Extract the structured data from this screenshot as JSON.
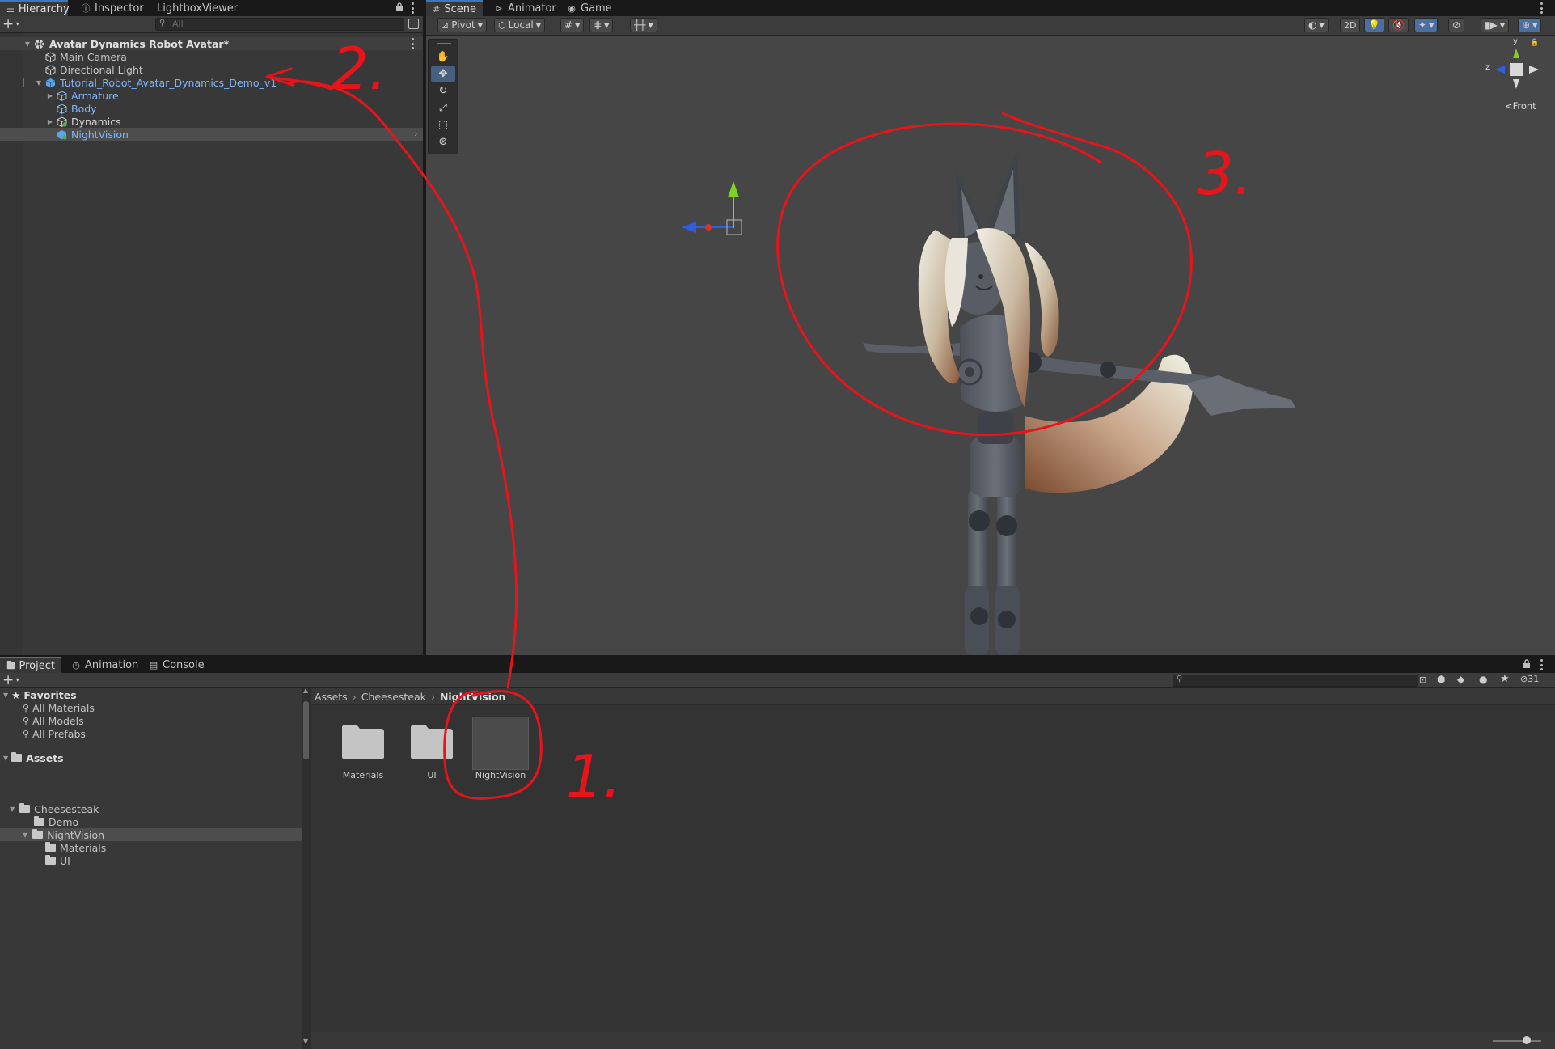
{
  "hierarchy": {
    "tabs": [
      "Hierarchy",
      "Inspector",
      "LightboxViewer"
    ],
    "search_placeholder": "All",
    "scene_name": "Avatar Dynamics Robot Avatar*",
    "items": [
      {
        "label": "Main Camera"
      },
      {
        "label": "Directional Light"
      },
      {
        "label": "Tutorial_Robot_Avatar_Dynamics_Demo_v1"
      },
      {
        "label": "Armature"
      },
      {
        "label": "Body"
      },
      {
        "label": "Dynamics"
      },
      {
        "label": "NightVision"
      }
    ]
  },
  "scene": {
    "tabs": [
      "Scene",
      "Animator",
      "Game"
    ],
    "pivot_label": "Pivot",
    "local_label": "Local",
    "mode_2d": "2D",
    "gizmo": {
      "y": "y",
      "z": "z",
      "view_label": "Front"
    }
  },
  "project": {
    "tabs": [
      "Project",
      "Animation",
      "Console"
    ],
    "hidden_count": "31",
    "favorites_label": "Favorites",
    "favorites": [
      "All Materials",
      "All Models",
      "All Prefabs"
    ],
    "assets_label": "Assets",
    "tree": {
      "cheesesteak": "Cheesesteak",
      "demo": "Demo",
      "nightvision": "NightVision",
      "materials": "Materials",
      "ui": "UI"
    },
    "breadcrumb": [
      "Assets",
      "Cheesesteak",
      "NightVision"
    ],
    "grid_items": [
      {
        "label": "Materials"
      },
      {
        "label": "UI"
      },
      {
        "label": "NightVision"
      }
    ]
  },
  "annotations": {
    "color": "#e8141b",
    "labels": [
      "1.",
      "2.",
      "3."
    ]
  },
  "colors": {
    "selection_accent": "#3a79bb",
    "prefab_blue": "#7fb6ff",
    "axis_x": "#e0302a",
    "axis_y": "#7ed321",
    "axis_z": "#2f5fe0"
  }
}
